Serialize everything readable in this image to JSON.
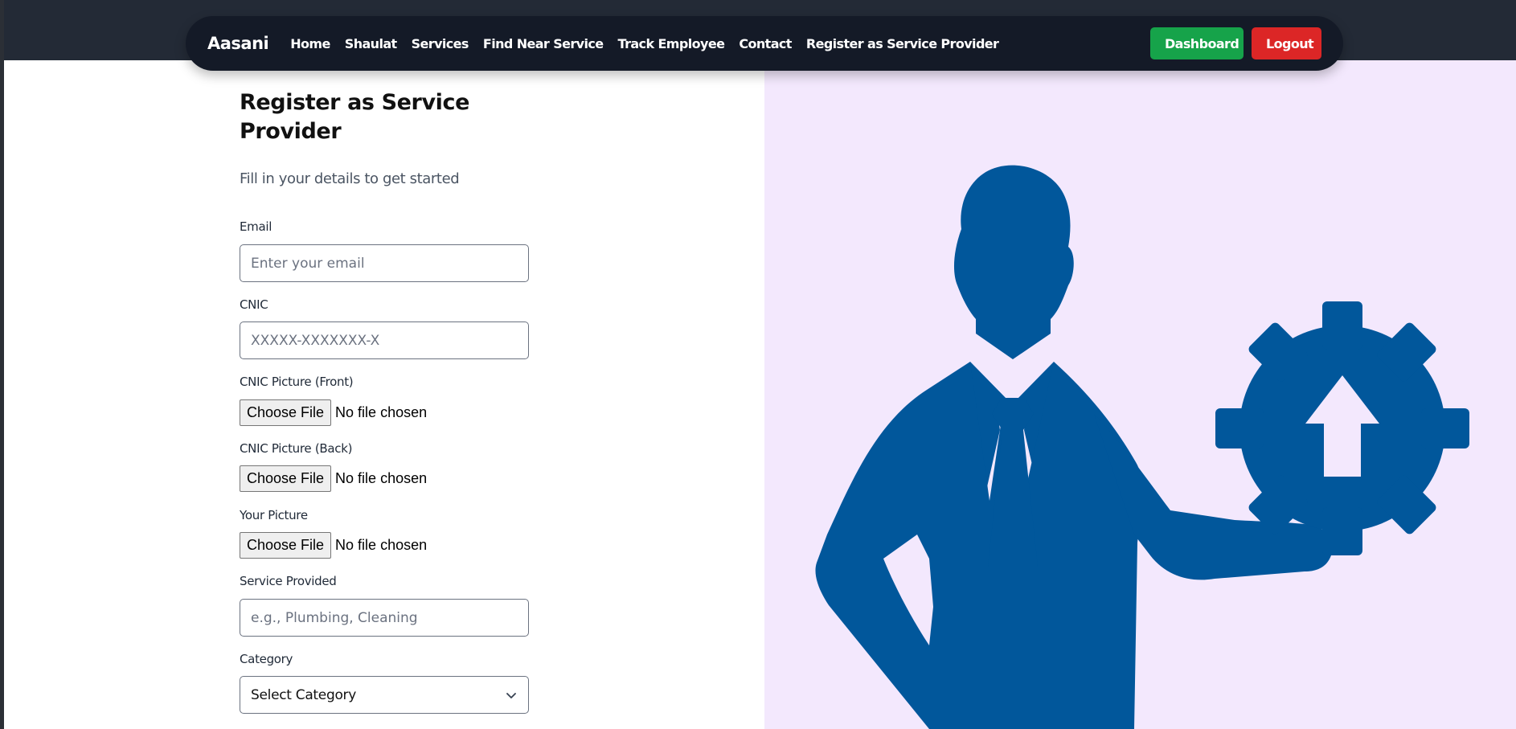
{
  "brand": "Aasani",
  "nav": {
    "links": [
      "Home",
      "Shaulat",
      "Services",
      "Find Near Service",
      "Track Employee",
      "Contact",
      "Register as Service Provider"
    ],
    "dashboard_label": "Dashboard",
    "logout_label": "Logout"
  },
  "form": {
    "title": "Register as Service Provider",
    "subtitle": "Fill in your details to get started",
    "email": {
      "label": "Email",
      "placeholder": "Enter your email"
    },
    "cnic": {
      "label": "CNIC",
      "placeholder": "XXXXX-XXXXXXX-X"
    },
    "cnic_front": {
      "label": "CNIC Picture (Front)",
      "button": "Choose File",
      "status": "No file chosen"
    },
    "cnic_back": {
      "label": "CNIC Picture (Back)",
      "button": "Choose File",
      "status": "No file chosen"
    },
    "your_picture": {
      "label": "Your Picture",
      "button": "Choose File",
      "status": "No file chosen"
    },
    "service": {
      "label": "Service Provided",
      "placeholder": "e.g., Plumbing, Cleaning"
    },
    "category": {
      "label": "Category",
      "selected": "Select Category"
    }
  },
  "colors": {
    "navbar": "#141a27",
    "dashboard": "#16a34a",
    "logout": "#dc2626",
    "illustration_bg": "#f3e8fd",
    "illustration_fg": "#01579b"
  },
  "icons": {
    "illustration": "businessman-with-upload-gear-icon",
    "select_arrow": "chevron-down-icon"
  }
}
